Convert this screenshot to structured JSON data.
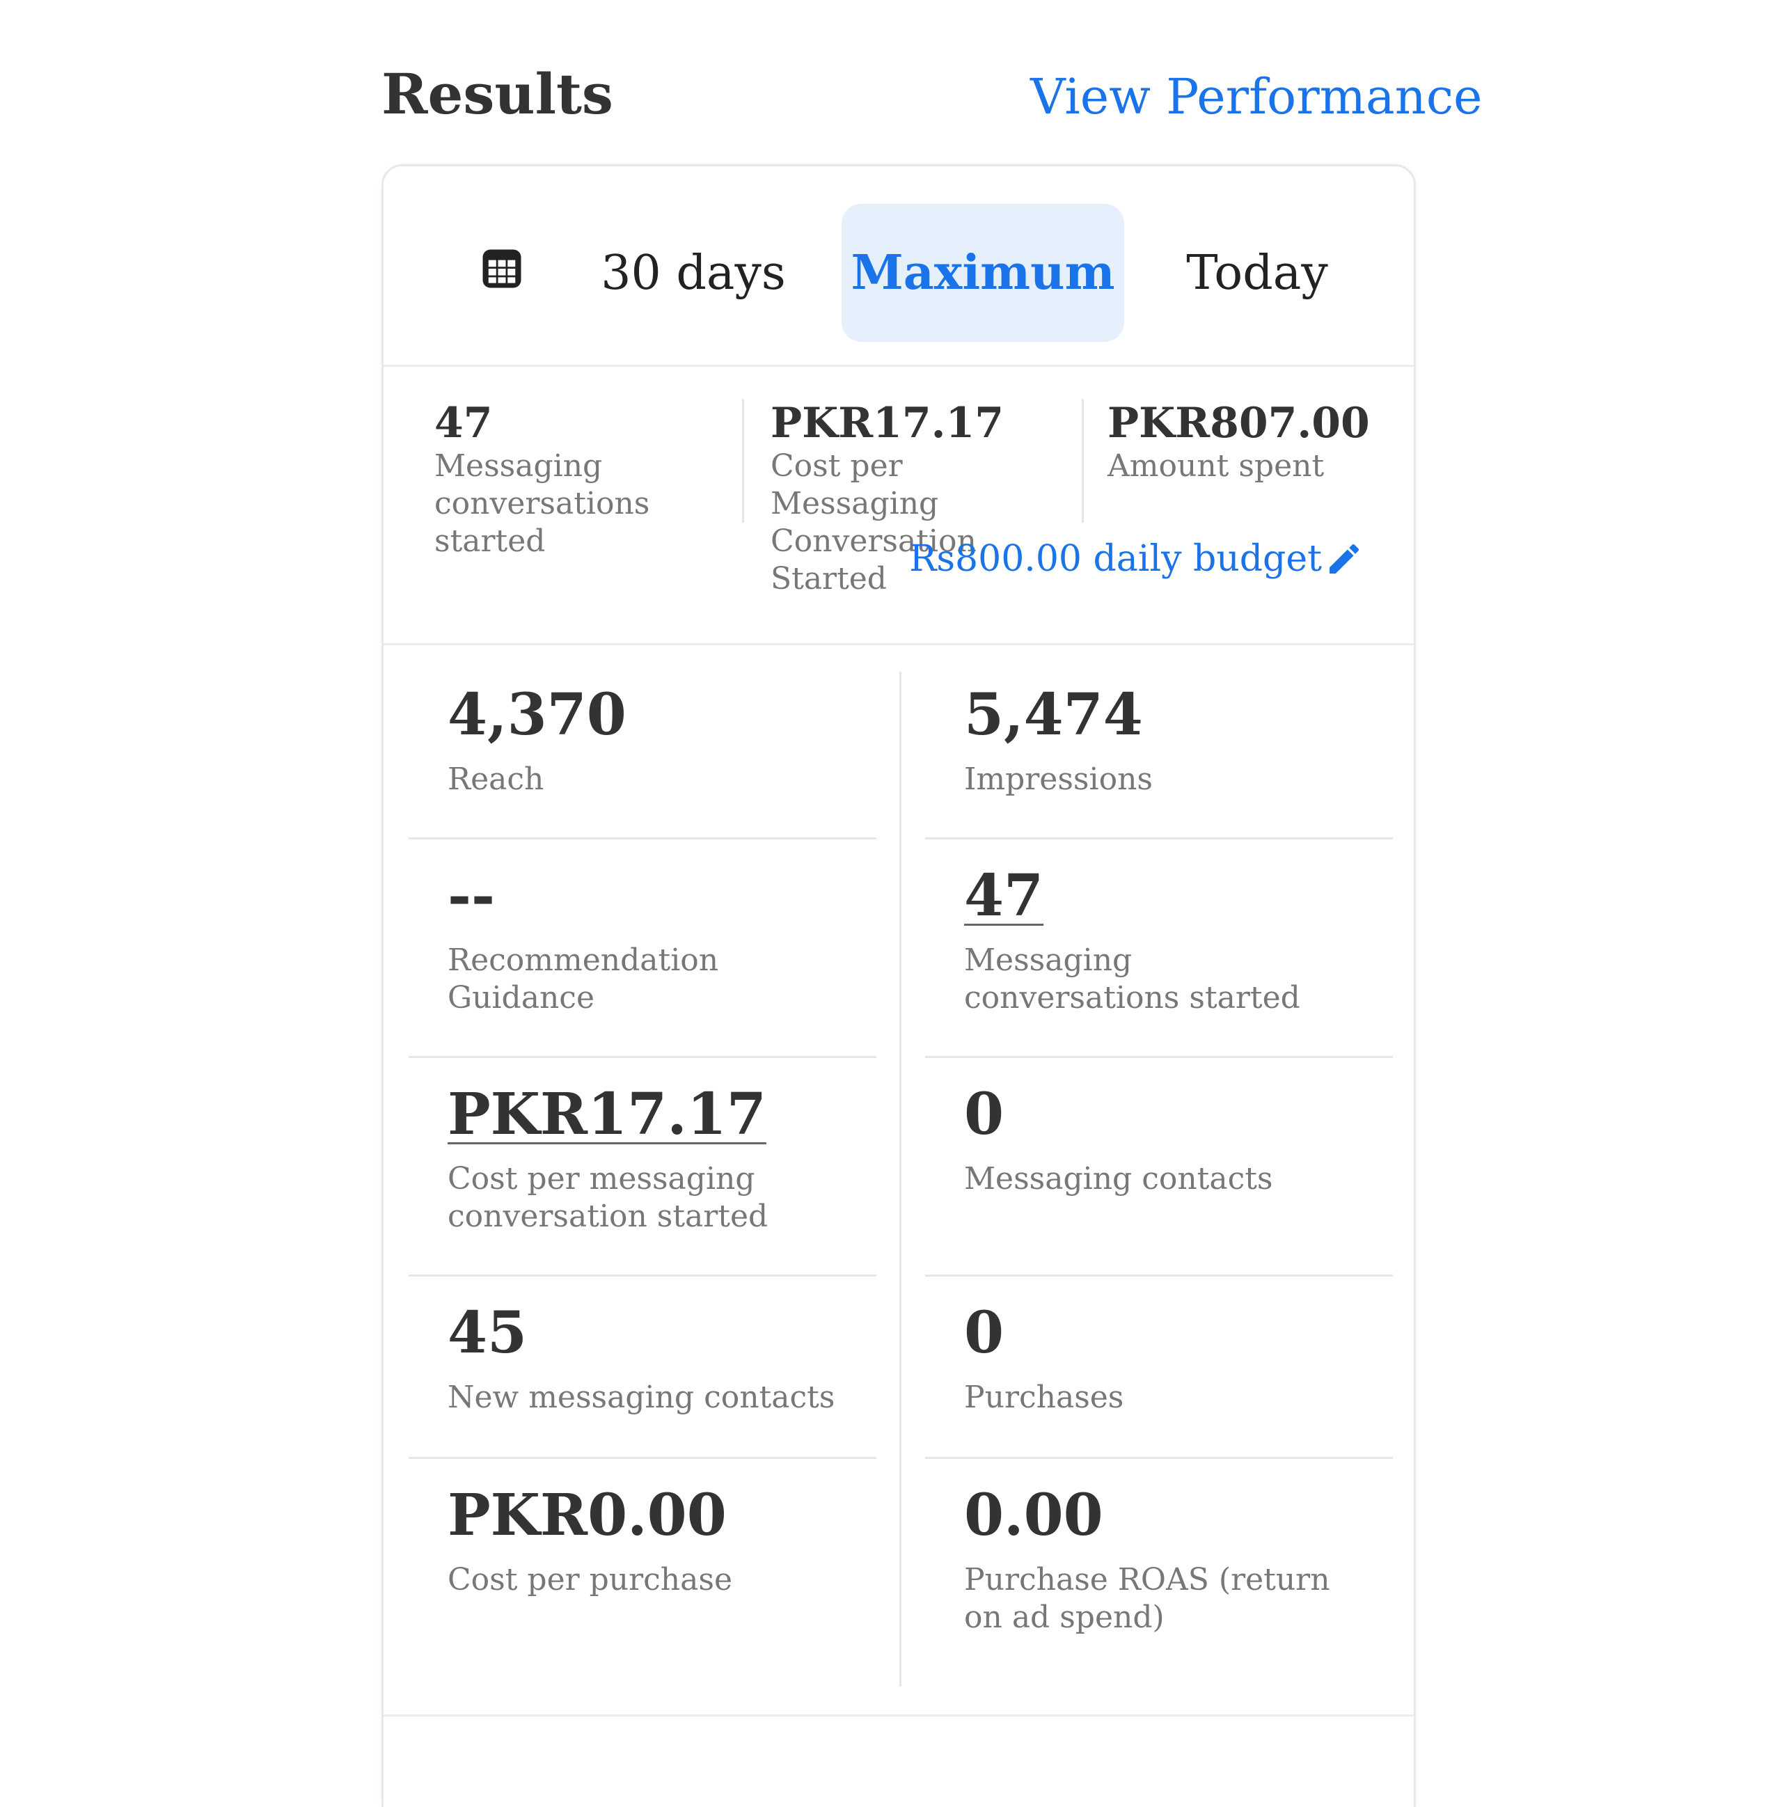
{
  "header": {
    "title": "Results",
    "view_performance": "View Performance"
  },
  "date_range": {
    "icon": "calendar-icon",
    "tabs": [
      "30 days",
      "Maximum",
      "Today"
    ],
    "selected": "Maximum"
  },
  "summary": {
    "items": [
      {
        "value": "47",
        "label": "Messaging conversations started"
      },
      {
        "value": "PKR17.17",
        "label": "Cost per Messaging Conversation Started"
      },
      {
        "value": "PKR807.00",
        "label": "Amount spent"
      }
    ],
    "budget": "Rs800.00 daily budget",
    "budget_icon": "pencil-icon"
  },
  "metrics": [
    {
      "value": "4,370",
      "label": "Reach"
    },
    {
      "value": "5,474",
      "label": "Impressions"
    },
    {
      "value": "--",
      "label": "Recommendation Guidance"
    },
    {
      "value": "47",
      "label": "Messaging conversations started"
    },
    {
      "value": "PKR17.17",
      "label": "Cost per messaging conversation started"
    },
    {
      "value": "0",
      "label": "Messaging contacts"
    },
    {
      "value": "45",
      "label": "New messaging contacts"
    },
    {
      "value": "0",
      "label": "Purchases"
    },
    {
      "value": "PKR0.00",
      "label": "Cost per purchase"
    },
    {
      "value": "0.00",
      "label": "Purchase ROAS (return on ad spend)"
    }
  ],
  "colors": {
    "accent": "#1a73e8",
    "selected_tab_bg": "#e5f0fc"
  }
}
